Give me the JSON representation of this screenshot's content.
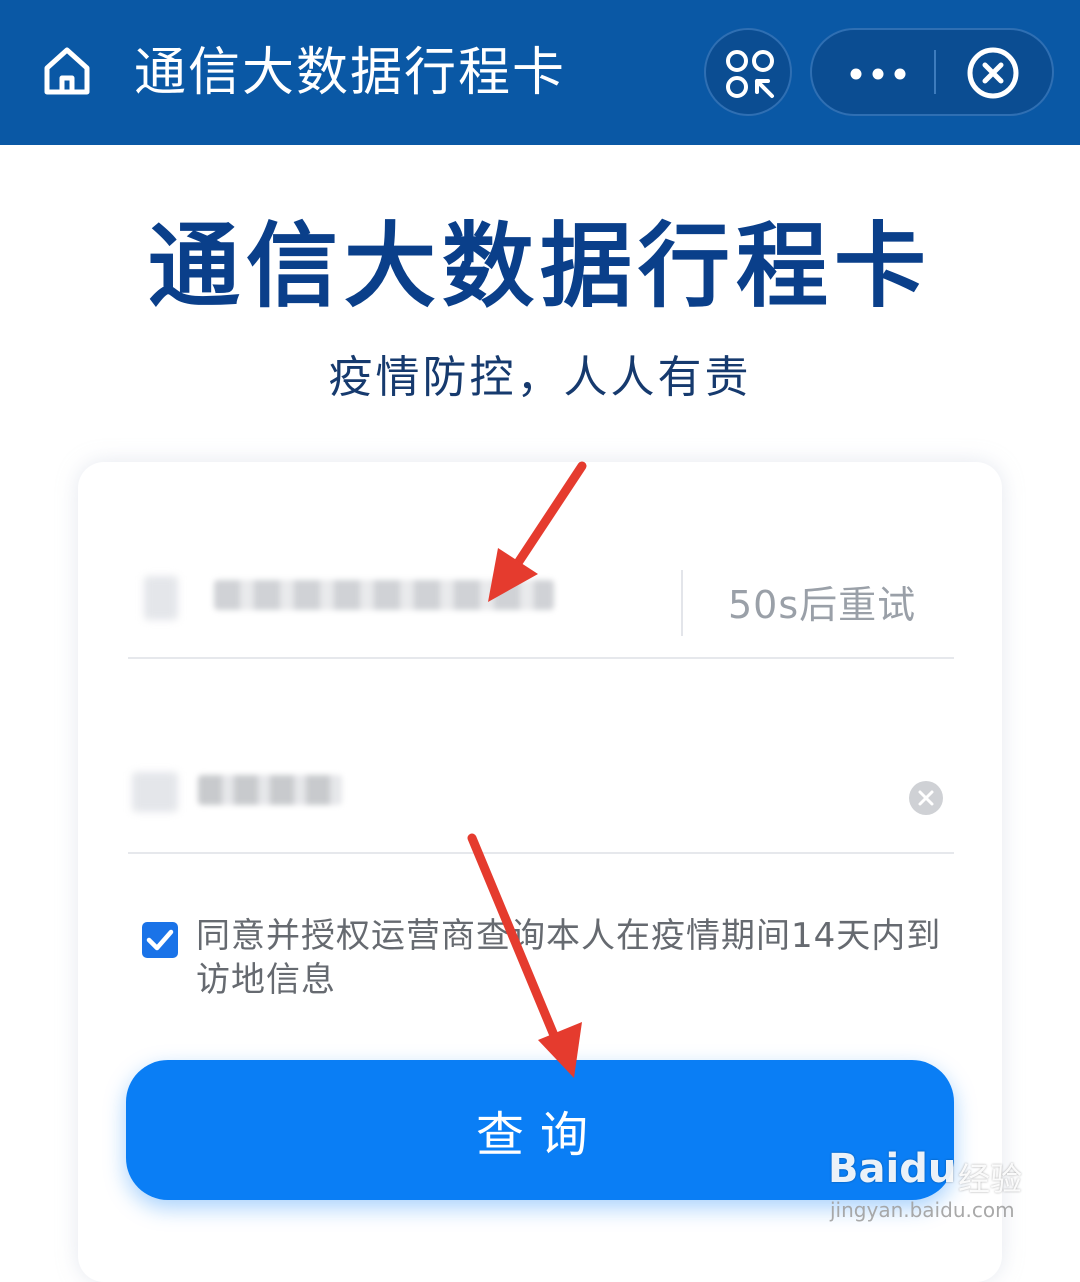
{
  "header": {
    "title": "通信大数据行程卡"
  },
  "page": {
    "title": "通信大数据行程卡",
    "subtitle": "疫情防控，人人有责"
  },
  "form": {
    "phone_value": "",
    "retry_label": "50s后重试",
    "code_value": "",
    "agreement_text": "同意并授权运营商查询本人在疫情期间14天内到访地信息",
    "agreement_checked": true,
    "query_label": "查询"
  },
  "watermark": {
    "brand": "Bai",
    "brand2": "du",
    "suffix": "经验",
    "url": "jingyan.baidu.com"
  },
  "colors": {
    "header_bg": "#0a58a5",
    "title": "#0a3f8a",
    "accent": "#0a7ef5",
    "annotation": "#e53b2e"
  },
  "icons": [
    "home-icon",
    "scan-icon",
    "more-icon",
    "close-icon",
    "clear-icon",
    "check-icon"
  ]
}
